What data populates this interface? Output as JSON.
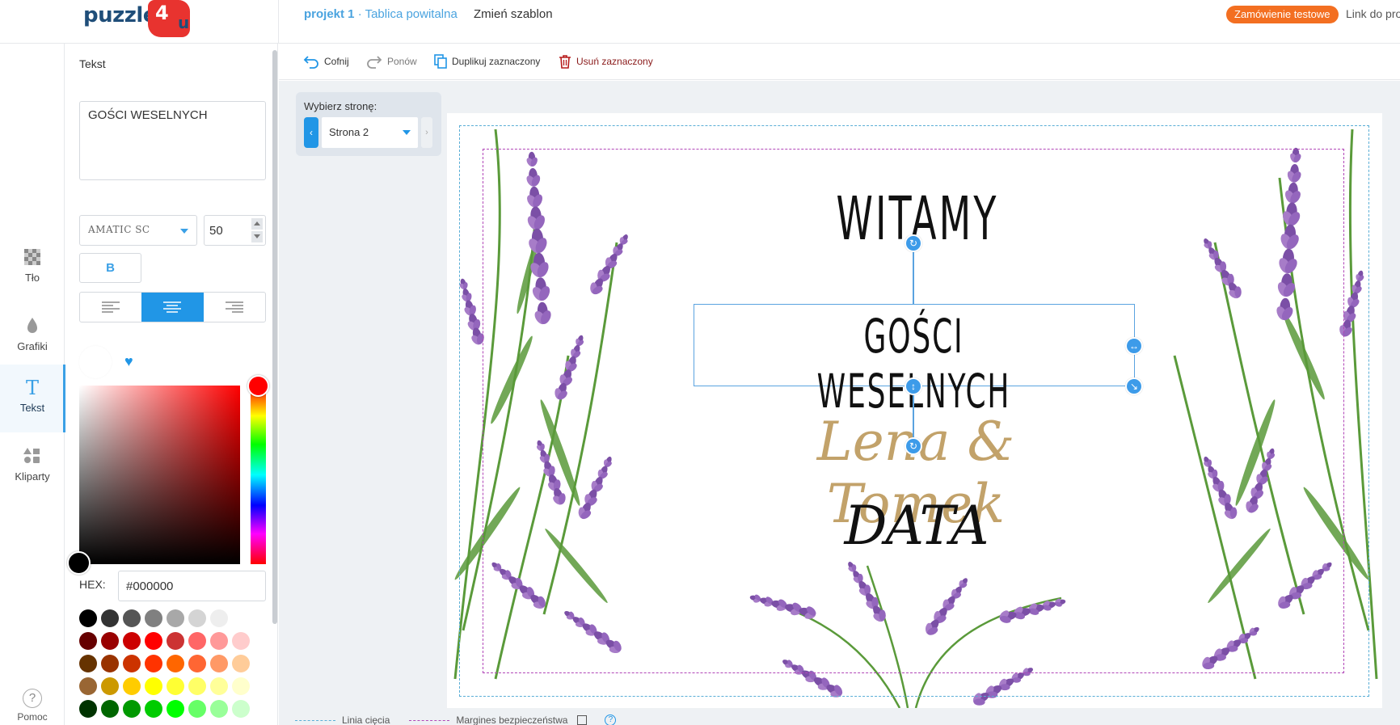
{
  "header": {
    "logo_text": "puzzle4u",
    "project_name": "projekt 1",
    "template_name": " · Tablica powitalna",
    "change_template": "Zmień szablon",
    "test_order": "Zamówienie testowe",
    "project_link": "Link do proj"
  },
  "nav": {
    "items": [
      {
        "label": "Tło",
        "icon": "checker-icon"
      },
      {
        "label": "Grafiki",
        "icon": "drop-icon"
      },
      {
        "label": "Tekst",
        "icon": "text-t-icon"
      },
      {
        "label": "Kliparty",
        "icon": "shapes-icon"
      }
    ],
    "help": "Pomoc",
    "help_glyph": "?"
  },
  "panel": {
    "title": "Tekst",
    "text_value": "GOŚCI WESELNYCH",
    "font": "AMATIC SC",
    "size": "50",
    "bold_label": "B",
    "hex_label": "HEX:",
    "hex_value": "#000000",
    "swatch_rows": [
      [
        "#000000",
        "#333333",
        "#555555",
        "#808080",
        "#a8a8a8",
        "#d4d4d4",
        "#eeeeee",
        "#ffffff"
      ],
      [
        "#660000",
        "#990000",
        "#cc0000",
        "#ff0000",
        "#cc3333",
        "#ff6666",
        "#ff9999",
        "#ffcccc"
      ],
      [
        "#663300",
        "#993300",
        "#cc3300",
        "#ff3300",
        "#ff6600",
        "#ff6633",
        "#ff9966",
        "#ffcc99"
      ],
      [
        "#996633",
        "#cc9900",
        "#ffcc00",
        "#ffff00",
        "#ffff33",
        "#ffff66",
        "#ffff99",
        "#ffffcc"
      ],
      [
        "#003300",
        "#006600",
        "#009900",
        "#00cc00",
        "#00ff00",
        "#66ff66",
        "#99ff99",
        "#ccffcc"
      ]
    ]
  },
  "toolbar": {
    "undo": "Cofnij",
    "redo": "Ponów",
    "duplicate": "Duplikuj zaznaczony",
    "delete": "Usuń zaznaczony"
  },
  "page_picker": {
    "label": "Wybierz stronę:",
    "selected": "Strona 2",
    "prev": "‹",
    "next": "›"
  },
  "canvas": {
    "line1": "WITAMY",
    "line2": "GOŚCI WESELNYCH",
    "line3": "Lena & Tomek",
    "line4": "DATA",
    "names_color": "#c2a26a"
  },
  "legend": {
    "cut_line": "Linia cięcia",
    "safe_margin": "Margines bezpieczeństwa",
    "help_glyph": "?"
  },
  "colors": {
    "accent": "#2196e6",
    "order_button": "#f36f21",
    "cut_line": "#5aaed6",
    "safe_margin": "#b146b8",
    "lavender": "#7b4fa6",
    "leaf": "#5a9a3a"
  }
}
